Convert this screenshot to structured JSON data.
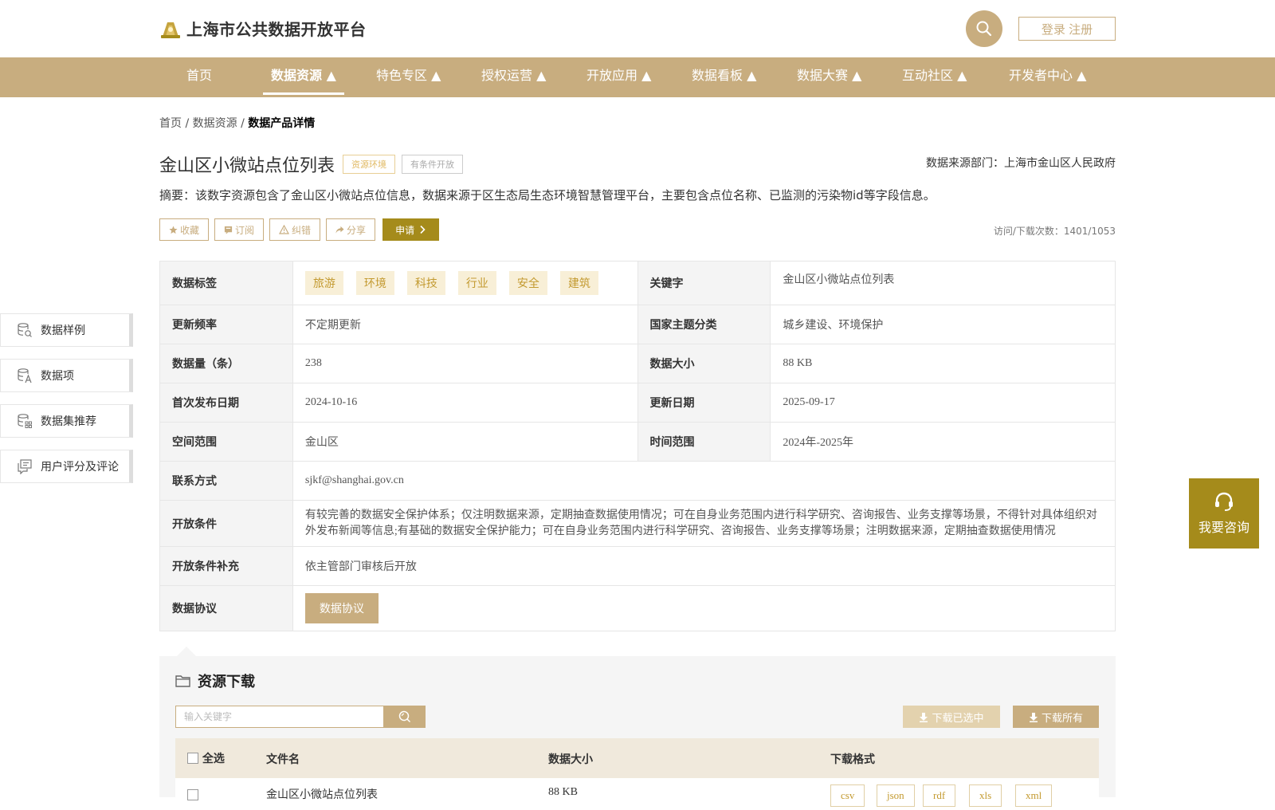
{
  "header": {
    "site_title": "上海市公共数据开放平台",
    "login_label": "登录 注册"
  },
  "nav": {
    "items": [
      {
        "label": "首页"
      },
      {
        "label": "数据资源 ▲"
      },
      {
        "label": "特色专区 ▲"
      },
      {
        "label": "授权运营 ▲"
      },
      {
        "label": "开放应用 ▲"
      },
      {
        "label": "数据看板 ▲"
      },
      {
        "label": "数据大赛 ▲"
      },
      {
        "label": "互动社区 ▲"
      },
      {
        "label": "开发者中心 ▲"
      }
    ],
    "active_index": 1
  },
  "breadcrumb": {
    "home": "首页",
    "sep": "/",
    "resources": "数据资源",
    "current": "数据产品详情"
  },
  "dataset": {
    "title": "金山区小微站点位列表",
    "category_tag": "资源环境",
    "open_tag": "有条件开放",
    "source_dept": "数据来源部门：上海市金山区人民政府",
    "abstract": "摘要：该数字资源包含了金山区小微站点位信息，数据来源于区生态局生态环境智慧管理平台，主要包含点位名称、已监测的污染物id等字段信息。",
    "visits": "访问/下载次数：1401/1053"
  },
  "actions": {
    "favorite": "收藏",
    "subscribe": "订阅",
    "correct": "纠错",
    "share": "分享",
    "apply": "申请"
  },
  "info": {
    "tags_label": "数据标签",
    "tags": [
      "旅游",
      "环境",
      "科技",
      "行业",
      "安全",
      "建筑"
    ],
    "keyword_label": "关键字",
    "keyword": "金山区小微站点位列表",
    "freq_label": "更新频率",
    "freq": "不定期更新",
    "theme_label": "国家主题分类",
    "theme": "城乡建设、环境保护",
    "count_label": "数据量（条）",
    "count": "238",
    "size_label": "数据大小",
    "size": "88 KB",
    "first_pub_label": "首次发布日期",
    "first_pub": "2024-10-16",
    "update_label": "更新日期",
    "update": "2025-09-17",
    "space_label": "空间范围",
    "space": "金山区",
    "time_label": "时间范围",
    "time": "2024年-2025年",
    "contact_label": "联系方式",
    "contact": "sjkf@shanghai.gov.cn",
    "cond_label": "开放条件",
    "cond": "有较完善的数据安全保护体系；仅注明数据来源，定期抽查数据使用情况；可在自身业务范围内进行科学研究、咨询报告、业务支撑等场景，不得针对具体组织对外发布新闻等信息;有基础的数据安全保护能力；可在自身业务范围内进行科学研究、咨询报告、业务支撑等场景；注明数据来源，定期抽查数据使用情况",
    "cond_extra_label": "开放条件补充",
    "cond_extra": "依主管部门审核后开放",
    "protocol_label": "数据协议",
    "protocol_btn": "数据协议"
  },
  "sidebar": {
    "items": [
      {
        "label": "数据样例",
        "icon": "database-icon"
      },
      {
        "label": "数据项",
        "icon": "data-item-icon"
      },
      {
        "label": "数据集推荐",
        "icon": "dataset-recommend-icon"
      },
      {
        "label": "用户评分及评论",
        "icon": "comment-icon"
      }
    ]
  },
  "consult": {
    "label": "我要咨询"
  },
  "resources": {
    "title": "资源下载",
    "search_placeholder": "输入关键字",
    "download_selected": "下载已选中",
    "download_all": "下载所有",
    "columns": {
      "select_all": "全选",
      "filename": "文件名",
      "size": "数据大小",
      "format": "下载格式"
    },
    "rows": [
      {
        "filename": "金山区小微站点位列表",
        "size": "88 KB",
        "formats": [
          "csv",
          "json",
          "rdf",
          "xls",
          "xml"
        ]
      }
    ]
  },
  "colors": {
    "brand": "#c8ad7f",
    "accent_dark": "#a58b1b"
  }
}
